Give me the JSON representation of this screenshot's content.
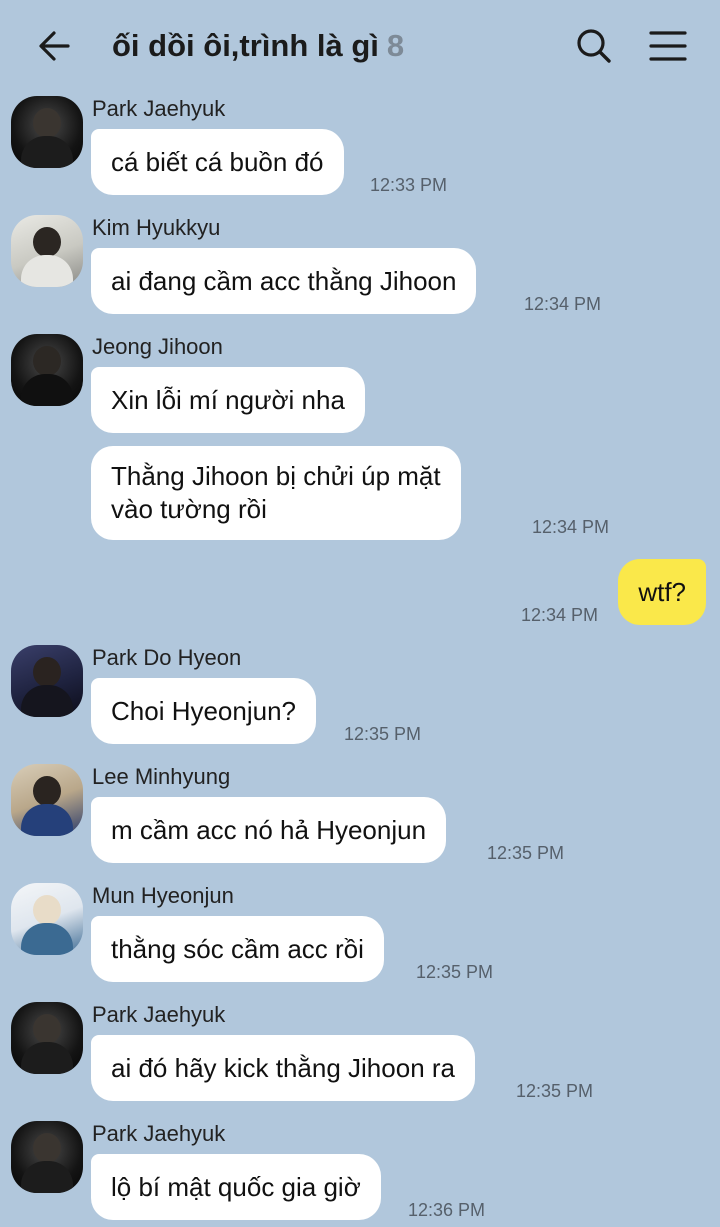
{
  "header": {
    "title": "ối dồi ôi,trình là gì",
    "member_count": "8",
    "icons": [
      "back-arrow-icon",
      "search-icon",
      "menu-icon"
    ]
  },
  "colors": {
    "background": "#b1c7dc",
    "bubble_incoming": "#ffffff",
    "bubble_outgoing": "#fae84a"
  },
  "messages": [
    {
      "sender": "Park Jaehyuk",
      "text": "cá biết cá buồn đó",
      "time": "12:33 PM"
    },
    {
      "sender": "Kim Hyukkyu",
      "text": "ai đang cầm acc thằng Jihoon",
      "time": "12:34 PM"
    },
    {
      "sender": "Jeong Jihoon",
      "text": "Xin lỗi mí người nha",
      "time": ""
    },
    {
      "sender": "",
      "text_line1": "Thằng Jihoon bị chửi úp mặt",
      "text_line2": "vào tường rồi",
      "time": "12:34 PM"
    },
    {
      "sender": "me",
      "text": "wtf?",
      "time": "12:34 PM"
    },
    {
      "sender": "Park Do Hyeon",
      "text": "Choi Hyeonjun?",
      "time": "12:35 PM"
    },
    {
      "sender": "Lee Minhyung",
      "text": "m cầm acc nó hả Hyeonjun",
      "time": "12:35 PM"
    },
    {
      "sender": "Mun Hyeonjun",
      "text": "thằng sóc cầm acc rồi",
      "time": "12:35 PM"
    },
    {
      "sender": "Park Jaehyuk",
      "text": "ai đó hãy kick thằng Jihoon ra",
      "time": "12:35 PM"
    },
    {
      "sender": "Park Jaehyuk",
      "text": "lộ bí mật quốc gia giờ",
      "time": "12:36 PM"
    }
  ]
}
